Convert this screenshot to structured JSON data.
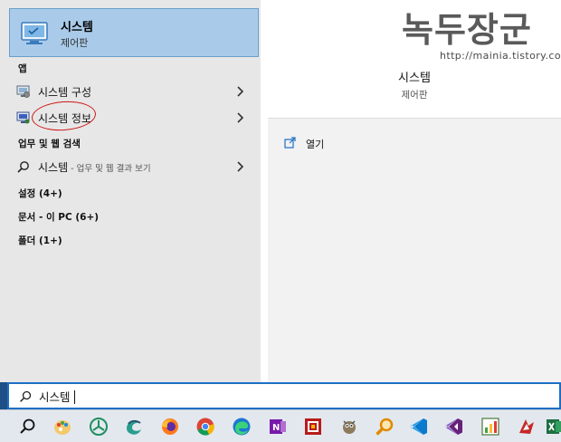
{
  "top_result": {
    "title": "시스템",
    "subtitle": "제어판"
  },
  "sections": {
    "apps": "앱",
    "web": "업무 및 웹 검색",
    "settings": "설정 (4+)",
    "documents": "문서 - 이 PC (6+)",
    "folders": "폴더 (1+)"
  },
  "apps": [
    {
      "label": "시스템 구성"
    },
    {
      "label": "시스템 정보"
    }
  ],
  "web_result": {
    "term": "시스템",
    "suffix": " - 업무 및 웹 결과 보기"
  },
  "preview": {
    "title": "시스템",
    "subtitle": "제어판",
    "open_label": "열기"
  },
  "watermark": {
    "logo": "녹두장군",
    "url": "http://mainia.tistory.com"
  },
  "search": {
    "value": "시스템"
  },
  "taskbar": {
    "icons": [
      "search-icon",
      "paint-icon",
      "kakao-icon",
      "edge-legacy-icon",
      "firefox-icon",
      "chrome-icon",
      "edge-icon",
      "onenote-icon",
      "filezilla-icon",
      "gimp-icon",
      "magnifier-icon",
      "vscode-icon",
      "visual-studio-icon",
      "excel-chart-icon",
      "game-icon",
      "excel-icon"
    ]
  },
  "colors": {
    "accent": "#1e6fc4",
    "selected": "#a9cbe9",
    "annotation": "#d01818"
  }
}
